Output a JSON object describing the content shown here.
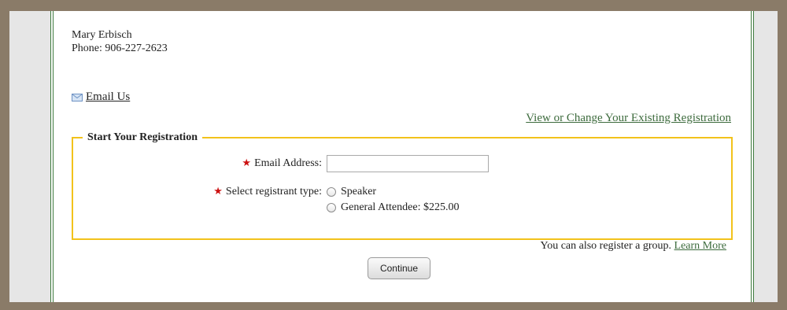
{
  "contact": {
    "name": "Mary Erbisch",
    "phone": "Phone: 906-227-2623"
  },
  "email_us": {
    "icon": "envelope-icon",
    "label": "Email Us"
  },
  "view_change_link": "View or Change Your Existing Registration",
  "registration": {
    "legend": "Start Your Registration",
    "required_mark": "★",
    "email_label": "Email Address:",
    "email_value": "",
    "type_label": "Select registrant type:",
    "options": [
      {
        "label": "Speaker",
        "selected": false
      },
      {
        "label": "General Attendee: $225.00",
        "selected": false
      }
    ],
    "group_text": "You can also register a group.",
    "learn_more": "Learn More"
  },
  "continue_label": "Continue",
  "colors": {
    "frame": "#8a7b68",
    "panel_border": "#3d7a3d",
    "fieldset_border": "#f2c21b",
    "link_green": "#3d6b3d",
    "required_red": "#cc1111"
  }
}
